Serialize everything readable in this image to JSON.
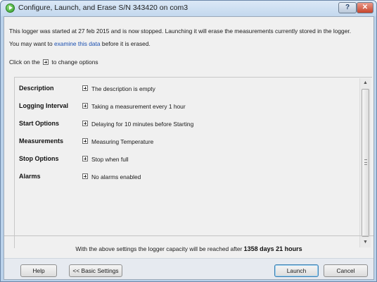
{
  "window": {
    "title": "Configure, Launch, and Erase S/N 343420 on com3",
    "help_button": "?",
    "close_button": "✕"
  },
  "info": {
    "line1": "This logger was started at 27 feb 2015 and is now stopped. Launching it will erase the measurements currently stored in the logger.",
    "line2_prefix": "You may want to",
    "link": "examine this data",
    "line2_suffix": "before it is erased."
  },
  "hint": {
    "prefix": "Click on the",
    "suffix": "to change options"
  },
  "options": [
    {
      "label": "Description",
      "value": "The description is empty"
    },
    {
      "label": "Logging Interval",
      "value": "Taking a measurement every 1 hour"
    },
    {
      "label": "Start Options",
      "value": "Delaying for 10 minutes before Starting"
    },
    {
      "label": "Measurements",
      "value": "Measuring Temperature"
    },
    {
      "label": "Stop Options",
      "value": "Stop when full"
    },
    {
      "label": "Alarms",
      "value": "No alarms enabled"
    }
  ],
  "capacity": {
    "prefix": "With the above settings the logger capacity will be reached after",
    "value": "1358 days 21 hours"
  },
  "buttons": {
    "help": "Help",
    "basic_settings": "<< Basic Settings",
    "launch": "Launch",
    "cancel": "Cancel"
  }
}
